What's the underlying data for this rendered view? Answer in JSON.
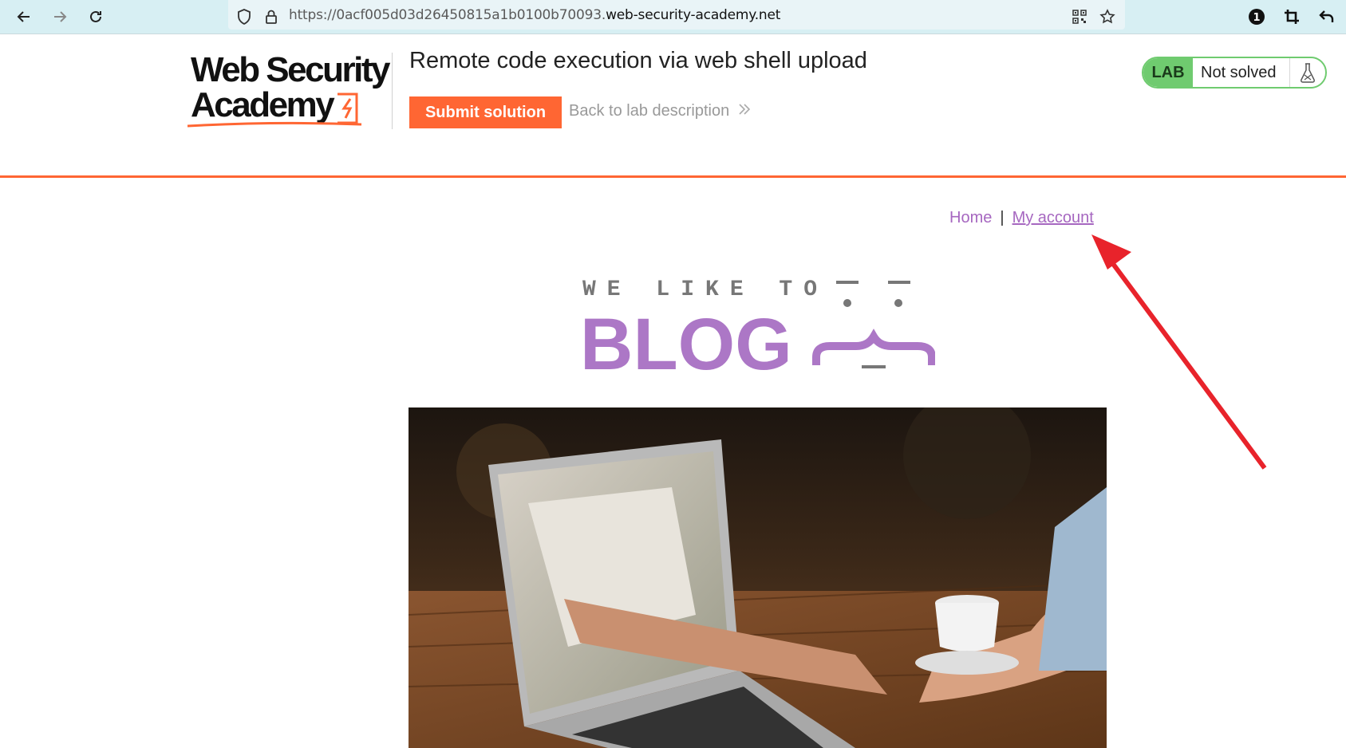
{
  "browser": {
    "url_prefix": "https://0acf005d03d26450815a1b0100b70093.",
    "url_domain": "web-security-academy.net"
  },
  "lab": {
    "logo_line1": "Web Security",
    "logo_line2": "Academy",
    "title": "Remote code execution via web shell upload",
    "submit_label": "Submit solution",
    "back_label": "Back to lab description",
    "badge_label": "LAB",
    "status": "Not solved"
  },
  "nav": {
    "home": "Home",
    "separator": "|",
    "account": "My account"
  },
  "banner": {
    "tagline": "WE LIKE TO",
    "word": "BLOG"
  },
  "colors": {
    "accent": "#ff6633",
    "blog_purple": "#ac77c6",
    "lab_green": "#6fcb6f",
    "annotation_red": "#e8232b"
  }
}
